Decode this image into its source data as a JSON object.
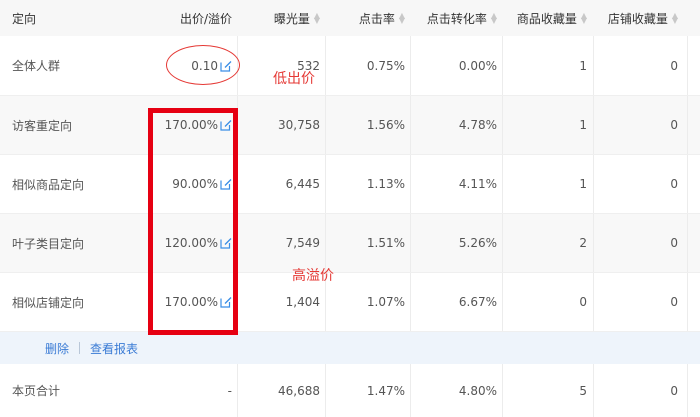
{
  "table": {
    "headers": [
      "定向",
      "出价/溢价",
      "曝光量",
      "点击率",
      "点击转化率",
      "商品收藏量",
      "店铺收藏量"
    ],
    "rows": [
      {
        "target": "全体人群",
        "bid": "0.10",
        "impressions": "532",
        "ctr": "0.75%",
        "cvr": "0.00%",
        "item_fav": "1",
        "shop_fav": "0"
      },
      {
        "target": "访客重定向",
        "bid": "170.00%",
        "impressions": "30,758",
        "ctr": "1.56%",
        "cvr": "4.78%",
        "item_fav": "1",
        "shop_fav": "0"
      },
      {
        "target": "相似商品定向",
        "bid": "90.00%",
        "impressions": "6,445",
        "ctr": "1.13%",
        "cvr": "4.11%",
        "item_fav": "1",
        "shop_fav": "0"
      },
      {
        "target": "叶子类目定向",
        "bid": "120.00%",
        "impressions": "7,549",
        "ctr": "1.51%",
        "cvr": "5.26%",
        "item_fav": "2",
        "shop_fav": "0"
      },
      {
        "target": "相似店铺定向",
        "bid": "170.00%",
        "impressions": "1,404",
        "ctr": "1.07%",
        "cvr": "6.67%",
        "item_fav": "0",
        "shop_fav": "0"
      }
    ],
    "actions": {
      "delete": "删除",
      "report": "查看报表"
    },
    "total": {
      "label": "本页合计",
      "bid": "-",
      "impressions": "46,688",
      "ctr": "1.47%",
      "cvr": "4.80%",
      "item_fav": "5",
      "shop_fav": "0"
    }
  },
  "annotations": {
    "low_bid": "低出价",
    "high_premium": "高溢价"
  },
  "icons": {
    "edit": "edit-icon",
    "sort": "sort-arrows-icon"
  },
  "colors": {
    "link": "#3a7bd5",
    "annotation": "#e53935",
    "highlight_box": "#e60012",
    "action_bar": "#eef4fb"
  }
}
